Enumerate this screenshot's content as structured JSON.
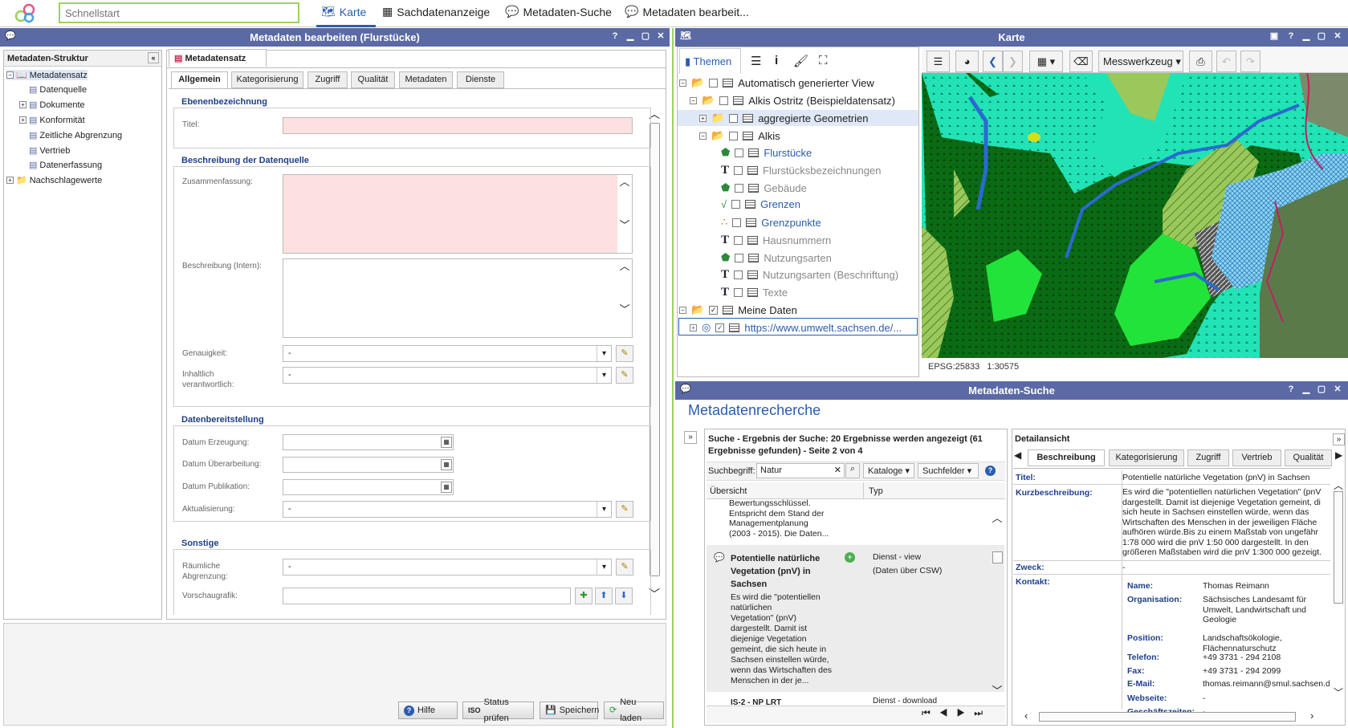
{
  "topbar": {
    "quickstart_placeholder": "Schnellstart",
    "tabs": [
      {
        "label": "Karte"
      },
      {
        "label": "Sachdatenanzeige"
      },
      {
        "label": "Metadaten-Suche"
      },
      {
        "label": "Metadaten bearbeit..."
      }
    ]
  },
  "editor": {
    "title": "Metadaten bearbeiten (Flurstücke)",
    "structure_title": "Metadaten-Struktur",
    "tree": [
      "Metadatensatz",
      "Datenquelle",
      "Dokumente",
      "Konformität",
      "Zeitliche Abgrenzung",
      "Vertrieb",
      "Datenerfassung",
      "Nachschlagewerte"
    ],
    "record_tab": "Metadatensatz",
    "tabs": [
      "Allgemein",
      "Kategorisierung",
      "Zugriff",
      "Qualität",
      "Metadaten",
      "Dienste"
    ],
    "sec1": "Ebenenbezeichnung",
    "titel": "Titel:",
    "sec2": "Beschreibung der Datenquelle",
    "zus": "Zusammenfassung:",
    "besch": "Beschreibung (Intern):",
    "gen": "Genauigkeit:",
    "gen_val": "-",
    "inh1": "Inhaltlich",
    "inh2": "verantwortlich:",
    "inh_val": "-",
    "sec3": "Datenbereitstellung",
    "d1": "Datum Erzeugung:",
    "d2": "Datum Überarbeitung:",
    "d3": "Datum Publikation:",
    "akt": "Aktualisierung:",
    "akt_val": "-",
    "sec4": "Sonstige",
    "raum1": "Räumliche",
    "raum2": "Abgrenzung:",
    "raum_val": "-",
    "vor": "Vorschaugrafik:",
    "buttons": {
      "help": "Hilfe",
      "iso": "ISO",
      "status": "Status prüfen",
      "save": "Speichern",
      "reload": "Neu laden"
    }
  },
  "map": {
    "title": "Karte",
    "themes_tab": "Themen",
    "measure": "Messwerkzeug",
    "crs": "EPSG:25833",
    "scale": "1:30575",
    "layers": [
      "Automatisch generierter View",
      "Alkis Ostritz (Beispieldatensatz)",
      "aggregierte Geometrien",
      "Alkis",
      "Flurstücke",
      "Flurstücksbezeichnungen",
      "Gebäude",
      "Grenzen",
      "Grenzpunkte",
      "Hausnummern",
      "Nutzungsarten",
      "Nutzungsarten (Beschriftung)",
      "Texte",
      "Meine Daten",
      "https://www.umwelt.sachsen.de/..."
    ]
  },
  "search": {
    "title": "Metadaten-Suche",
    "heading": "Metadatenrecherche",
    "result1": "Suche  -  Ergebnis der Suche: 20 Ergebnisse werden angezeigt (61",
    "result2": "Ergebnisse gefunden)  -  Seite 2 von 4",
    "term_label": "Suchbegriff:",
    "term": "Natur",
    "catalogs": "Kataloge",
    "fields": "Suchfelder",
    "col1": "Übersicht",
    "col2": "Typ",
    "prev_lines": [
      "Bewertungsschlüssel.",
      "Entspricht dem Stand der",
      "Managementplanung",
      "(2003 - 2015). Die Daten..."
    ],
    "item_title": [
      "Potentielle natürliche",
      "Vegetation (pnV) in",
      "Sachsen"
    ],
    "item_desc": [
      "Es wird die \"potentiellen",
      "natürlichen",
      "Vegetation\" (pnV)",
      "dargestellt. Damit ist",
      "diejenige Vegetation",
      "gemeint, die sich heute in",
      "Sachsen einstellen würde,",
      "wenn das Wirtschaften des",
      "Menschen in der je..."
    ],
    "item_type1": "Dienst - view",
    "item_type2": "(Daten über CSW)",
    "next_title": "IS-2 - NP LRT",
    "next_type": "Dienst - download",
    "detail_title": "Detailansicht",
    "dtabs": [
      "Beschreibung",
      "Kategorisierung",
      "Zugriff",
      "Vertrieb",
      "Qualität"
    ],
    "d_titel_l": "Titel:",
    "d_titel": "Potentielle natürliche Vegetation (pnV) in Sachsen",
    "d_kurz_l": "Kurzbeschreibung:",
    "d_kurz": [
      "Es wird die \"potentiellen natürlichen Vegetation\" (pnV",
      "dargestellt. Damit ist diejenige Vegetation gemeint, di",
      "sich heute in Sachsen einstellen würde, wenn das",
      "Wirtschaften des Menschen in der jeweiligen Fläche",
      "aufhören würde.Bis zu einem Maßstab von ungefähr",
      "1:78 000 wird die pnV 1:50 000 dargestellt. In den",
      "größeren Maßstaben wird die pnV 1:300 000 gezeigt."
    ],
    "d_zweck_l": "Zweck:",
    "d_zweck": "-",
    "d_kontakt_l": "Kontakt:",
    "contact": [
      {
        "k": "Name:",
        "v": [
          "Thomas Reimann"
        ]
      },
      {
        "k": "Organisation:",
        "v": [
          "Sächsisches Landesamt für",
          "Umwelt, Landwirtschaft und",
          "Geologie"
        ]
      },
      {
        "k": "Position:",
        "v": [
          "Landschaftsökologie,",
          "Flächennaturschutz"
        ]
      },
      {
        "k": "Telefon:",
        "v": [
          "+49 3731 - 294 2108"
        ]
      },
      {
        "k": "Fax:",
        "v": [
          "+49 3731 - 294 2099"
        ]
      },
      {
        "k": "E-Mail:",
        "v": [
          "thomas.reimann@smul.sachsen.d"
        ]
      },
      {
        "k": "Webseite:",
        "v": [
          "-"
        ]
      },
      {
        "k": "Geschäftszeiten:",
        "v": [
          "-"
        ]
      }
    ]
  },
  "colors": {
    "header": "#5b6aa5",
    "accent": "#2a5db0",
    "pink": "#fde0e0",
    "map_dark": "#0a6b14",
    "map_cyan": "#22e3b5"
  }
}
